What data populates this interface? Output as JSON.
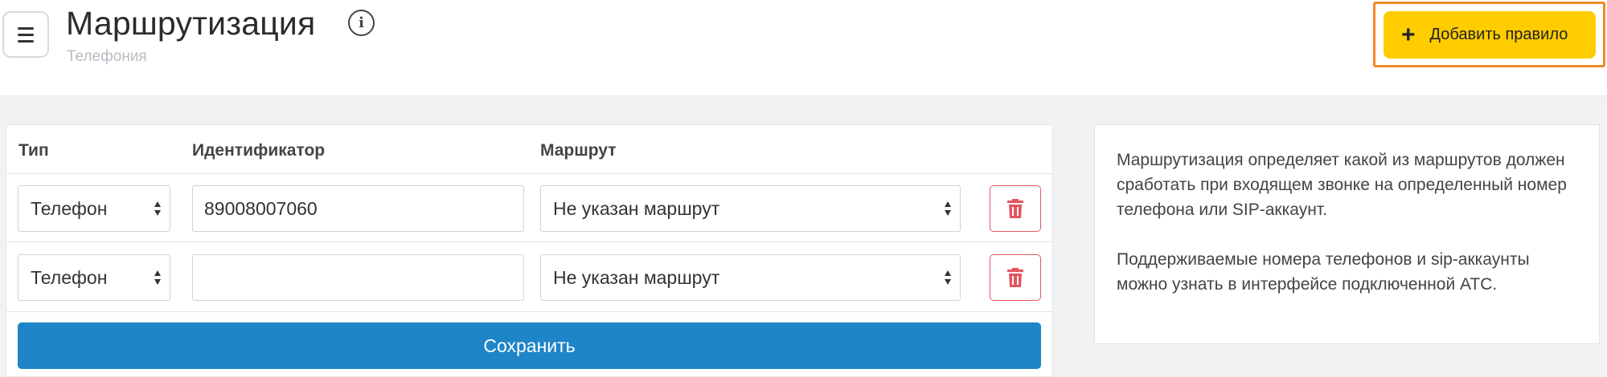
{
  "header": {
    "title": "Маршрутизация",
    "subtitle": "Телефония",
    "info_icon": "info-icon",
    "add_button_label": "Добавить правило",
    "add_button_icon": "plus-icon",
    "menu_icon": "hamburger-menu-icon"
  },
  "table": {
    "columns": [
      "Тип",
      "Идентификатор",
      "Маршрут"
    ],
    "rows": [
      {
        "type": "Телефон",
        "identifier": "89008007060",
        "route": "Не указан маршрут"
      },
      {
        "type": "Телефон",
        "identifier": "",
        "route": "Не указан маршрут"
      }
    ],
    "save_label": "Сохранить"
  },
  "help": {
    "paragraphs": [
      "Маршрутизация определяет какой из маршрутов должен сработать при входящем звонке на определенный номер телефона или SIP-аккаунт.",
      "Поддерживаемые номера телефонов и sip-аккаунты можно узнать в интерфейсе подключенной АТС."
    ]
  },
  "colors": {
    "accent_yellow": "#ffcc00",
    "highlight_orange": "#f08a24",
    "primary_blue": "#1f85c9",
    "danger_red": "#e25560"
  }
}
